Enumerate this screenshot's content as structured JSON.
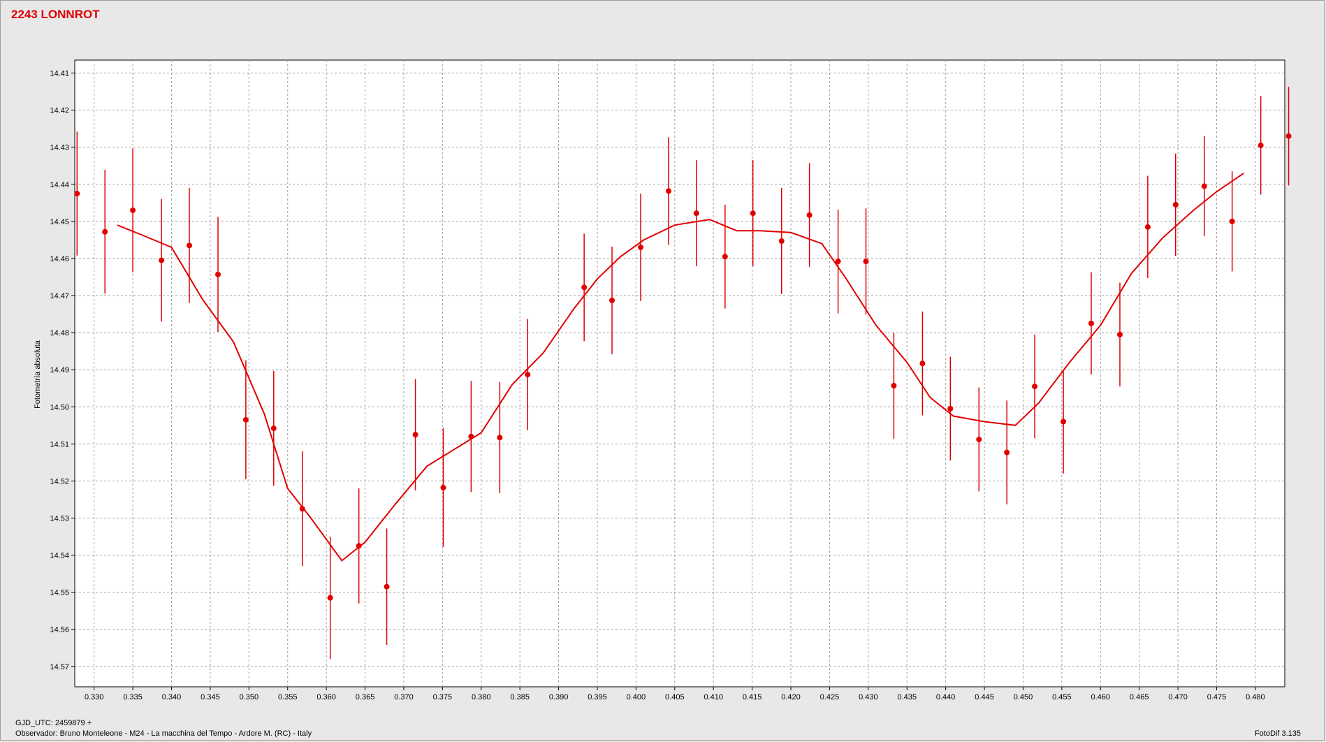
{
  "title": "2243 LONNROT",
  "footer": {
    "gjd": "GJD_UTC: 2459879 +",
    "observer": "Observador: Bruno Monteleone - M24 - La macchina del Tempo - Ardore M. (RC) - Italy",
    "version": "FotoDif 3.135"
  },
  "colors": {
    "series": "#e00000",
    "background": "#e8e8e8",
    "plot_bg": "#ffffff",
    "grid": "#a0a0a0"
  },
  "chart_data": {
    "type": "scatter",
    "title": "2243 LONNROT",
    "xlabel": "",
    "ylabel": "Fotometría absoluta",
    "xlim": [
      0.3275,
      0.4838
    ],
    "ylim": [
      14.4065,
      14.5755
    ],
    "y_inverted": true,
    "grid": true,
    "x_ticks": [
      0.33,
      0.335,
      0.34,
      0.345,
      0.35,
      0.355,
      0.36,
      0.365,
      0.37,
      0.375,
      0.38,
      0.385,
      0.39,
      0.395,
      0.4,
      0.405,
      0.41,
      0.415,
      0.42,
      0.425,
      0.43,
      0.435,
      0.44,
      0.445,
      0.45,
      0.455,
      0.46,
      0.465,
      0.47,
      0.475,
      0.48
    ],
    "x_tick_labels": [
      "0.330",
      "0.335",
      "0.340",
      "0.345",
      "0.350",
      "0.355",
      "0.360",
      "0.365",
      "0.370",
      "0.375",
      "0.380",
      "0.385",
      "0.390",
      "0.395",
      "0.400",
      "0.405",
      "0.410",
      "0.415",
      "0.420",
      "0.425",
      "0.430",
      "0.435",
      "0.440",
      "0.445",
      "0.450",
      "0.455",
      "0.460",
      "0.465",
      "0.470",
      "0.475",
      "0.480"
    ],
    "y_ticks": [
      14.41,
      14.42,
      14.43,
      14.44,
      14.45,
      14.46,
      14.47,
      14.48,
      14.49,
      14.5,
      14.51,
      14.52,
      14.53,
      14.54,
      14.55,
      14.56,
      14.57
    ],
    "y_tick_labels": [
      "14.41",
      "14.42",
      "14.43",
      "14.44",
      "14.45",
      "14.46",
      "14.47",
      "14.48",
      "14.49",
      "14.50",
      "14.51",
      "14.52",
      "14.53",
      "14.54",
      "14.55",
      "14.56",
      "14.57"
    ],
    "series": [
      {
        "kind": "points_with_error",
        "color": "#e00000",
        "points": [
          {
            "x": 0.3278,
            "y": 14.4425,
            "err": 0.0167
          },
          {
            "x": 0.3314,
            "y": 14.4528,
            "err": 0.0167
          },
          {
            "x": 0.335,
            "y": 14.447,
            "err": 0.0167
          },
          {
            "x": 0.3387,
            "y": 14.4605,
            "err": 0.0165
          },
          {
            "x": 0.3423,
            "y": 14.4565,
            "err": 0.0155
          },
          {
            "x": 0.346,
            "y": 14.4643,
            "err": 0.0155
          },
          {
            "x": 0.3496,
            "y": 14.5035,
            "err": 0.016
          },
          {
            "x": 0.3532,
            "y": 14.5058,
            "err": 0.0155
          },
          {
            "x": 0.3569,
            "y": 14.5275,
            "err": 0.0155
          },
          {
            "x": 0.3605,
            "y": 14.5515,
            "err": 0.0165
          },
          {
            "x": 0.3642,
            "y": 14.5375,
            "err": 0.0155
          },
          {
            "x": 0.3678,
            "y": 14.5485,
            "err": 0.0157
          },
          {
            "x": 0.3715,
            "y": 14.5075,
            "err": 0.015
          },
          {
            "x": 0.3751,
            "y": 14.5218,
            "err": 0.016
          },
          {
            "x": 0.3787,
            "y": 14.508,
            "err": 0.015
          },
          {
            "x": 0.3824,
            "y": 14.5083,
            "err": 0.015
          },
          {
            "x": 0.386,
            "y": 14.4913,
            "err": 0.015
          },
          {
            "x": 0.3933,
            "y": 14.4678,
            "err": 0.0145
          },
          {
            "x": 0.3969,
            "y": 14.4713,
            "err": 0.0145
          },
          {
            "x": 0.4006,
            "y": 14.457,
            "err": 0.0145
          },
          {
            "x": 0.4042,
            "y": 14.4418,
            "err": 0.0145
          },
          {
            "x": 0.4078,
            "y": 14.4478,
            "err": 0.0143
          },
          {
            "x": 0.4115,
            "y": 14.4595,
            "err": 0.014
          },
          {
            "x": 0.4151,
            "y": 14.4478,
            "err": 0.0143
          },
          {
            "x": 0.4188,
            "y": 14.4553,
            "err": 0.0143
          },
          {
            "x": 0.4224,
            "y": 14.4483,
            "err": 0.014
          },
          {
            "x": 0.4261,
            "y": 14.4608,
            "err": 0.014
          },
          {
            "x": 0.4297,
            "y": 14.4608,
            "err": 0.0143
          },
          {
            "x": 0.4333,
            "y": 14.4943,
            "err": 0.0143
          },
          {
            "x": 0.437,
            "y": 14.4883,
            "err": 0.014
          },
          {
            "x": 0.4406,
            "y": 14.5005,
            "err": 0.014
          },
          {
            "x": 0.4443,
            "y": 14.5088,
            "err": 0.014
          },
          {
            "x": 0.4479,
            "y": 14.5123,
            "err": 0.014
          },
          {
            "x": 0.4515,
            "y": 14.4945,
            "err": 0.014
          },
          {
            "x": 0.4552,
            "y": 14.504,
            "err": 0.014
          },
          {
            "x": 0.4588,
            "y": 14.4775,
            "err": 0.0138
          },
          {
            "x": 0.4625,
            "y": 14.4805,
            "err": 0.014
          },
          {
            "x": 0.4661,
            "y": 14.4515,
            "err": 0.0138
          },
          {
            "x": 0.4697,
            "y": 14.4455,
            "err": 0.0138
          },
          {
            "x": 0.4734,
            "y": 14.4405,
            "err": 0.0135
          },
          {
            "x": 0.477,
            "y": 14.45,
            "err": 0.0135
          },
          {
            "x": 0.4807,
            "y": 14.4295,
            "err": 0.0133
          },
          {
            "x": 0.4843,
            "y": 14.427,
            "err": 0.0133
          }
        ]
      },
      {
        "kind": "line",
        "color": "#e00000",
        "x": [
          0.333,
          0.336,
          0.34,
          0.344,
          0.348,
          0.352,
          0.355,
          0.358,
          0.362,
          0.365,
          0.369,
          0.373,
          0.3765,
          0.38,
          0.384,
          0.388,
          0.392,
          0.395,
          0.398,
          0.401,
          0.405,
          0.4095,
          0.413,
          0.416,
          0.42,
          0.424,
          0.427,
          0.431,
          0.435,
          0.438,
          0.441,
          0.445,
          0.449,
          0.452,
          0.456,
          0.46,
          0.464,
          0.468,
          0.472,
          0.475,
          0.4785
        ],
        "y": [
          14.451,
          14.4535,
          14.457,
          14.471,
          14.4825,
          14.502,
          14.522,
          14.53,
          14.5415,
          14.5365,
          14.526,
          14.516,
          14.5115,
          14.507,
          14.494,
          14.4855,
          14.4735,
          14.4655,
          14.4595,
          14.455,
          14.451,
          14.4495,
          14.4525,
          14.4525,
          14.453,
          14.456,
          14.465,
          14.478,
          14.488,
          14.4975,
          14.5025,
          14.504,
          14.505,
          14.499,
          14.488,
          14.478,
          14.464,
          14.4545,
          14.447,
          14.442,
          14.437
        ]
      }
    ]
  }
}
